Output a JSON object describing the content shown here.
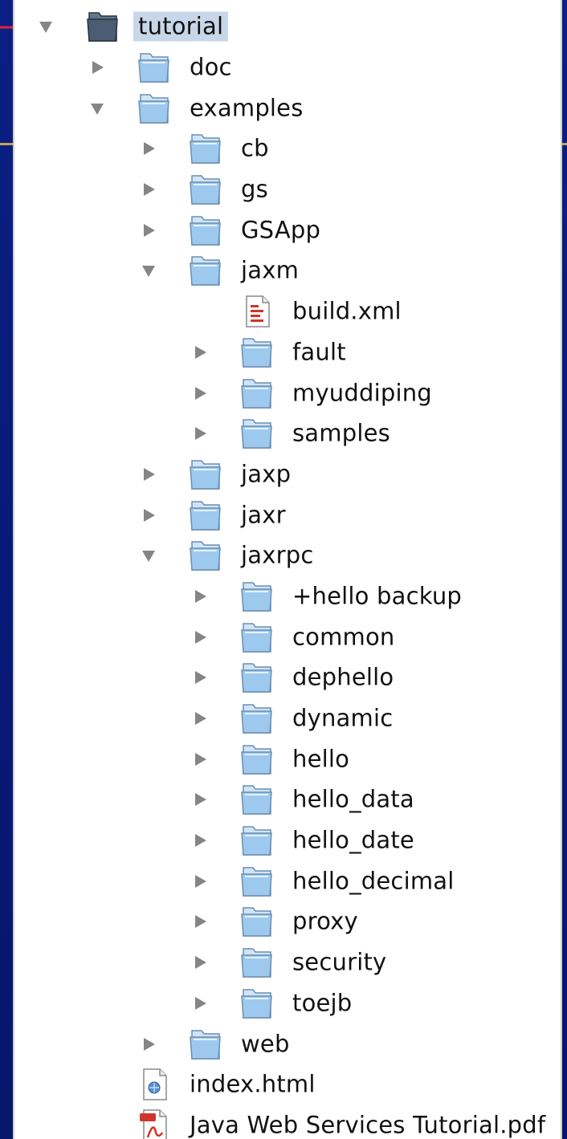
{
  "colors": {
    "background": "#0b1f84",
    "panel": "#ffffff",
    "selection": "#c8d6ea",
    "pointer": "#e0203a",
    "accent_line": "#d6b24a",
    "folder": "#9dc9ef"
  },
  "tree": {
    "root": {
      "label": "tutorial",
      "icon": "dark-folder-icon",
      "expanded": true,
      "selected": true
    },
    "items": [
      {
        "label": "doc",
        "level": 1,
        "type": "folder",
        "expanded": false
      },
      {
        "label": "examples",
        "level": 1,
        "type": "folder",
        "expanded": true
      },
      {
        "label": "cb",
        "level": 2,
        "type": "folder",
        "expanded": false
      },
      {
        "label": "gs",
        "level": 2,
        "type": "folder",
        "expanded": false
      },
      {
        "label": "GSApp",
        "level": 2,
        "type": "folder",
        "expanded": false
      },
      {
        "label": "jaxm",
        "level": 2,
        "type": "folder",
        "expanded": true
      },
      {
        "label": "build.xml",
        "level": 3,
        "type": "xml-file"
      },
      {
        "label": "fault",
        "level": 3,
        "type": "folder",
        "expanded": false
      },
      {
        "label": "myuddiping",
        "level": 3,
        "type": "folder",
        "expanded": false
      },
      {
        "label": "samples",
        "level": 3,
        "type": "folder",
        "expanded": false
      },
      {
        "label": "jaxp",
        "level": 2,
        "type": "folder",
        "expanded": false
      },
      {
        "label": "jaxr",
        "level": 2,
        "type": "folder",
        "expanded": false
      },
      {
        "label": "jaxrpc",
        "level": 2,
        "type": "folder",
        "expanded": true
      },
      {
        "label": "+hello backup",
        "level": 3,
        "type": "folder",
        "expanded": false
      },
      {
        "label": "common",
        "level": 3,
        "type": "folder",
        "expanded": false
      },
      {
        "label": "dephello",
        "level": 3,
        "type": "folder",
        "expanded": false
      },
      {
        "label": "dynamic",
        "level": 3,
        "type": "folder",
        "expanded": false
      },
      {
        "label": "hello",
        "level": 3,
        "type": "folder",
        "expanded": false
      },
      {
        "label": "hello_data",
        "level": 3,
        "type": "folder",
        "expanded": false
      },
      {
        "label": "hello_date",
        "level": 3,
        "type": "folder",
        "expanded": false
      },
      {
        "label": "hello_decimal",
        "level": 3,
        "type": "folder",
        "expanded": false
      },
      {
        "label": "proxy",
        "level": 3,
        "type": "folder",
        "expanded": false
      },
      {
        "label": "security",
        "level": 3,
        "type": "folder",
        "expanded": false
      },
      {
        "label": "toejb",
        "level": 3,
        "type": "folder",
        "expanded": false
      },
      {
        "label": "web",
        "level": 2,
        "type": "folder",
        "expanded": false
      },
      {
        "label": "index.html",
        "level": 1,
        "type": "html-file"
      },
      {
        "label": "Java Web Services Tutorial.pdf",
        "level": 1,
        "type": "pdf-file"
      }
    ]
  }
}
